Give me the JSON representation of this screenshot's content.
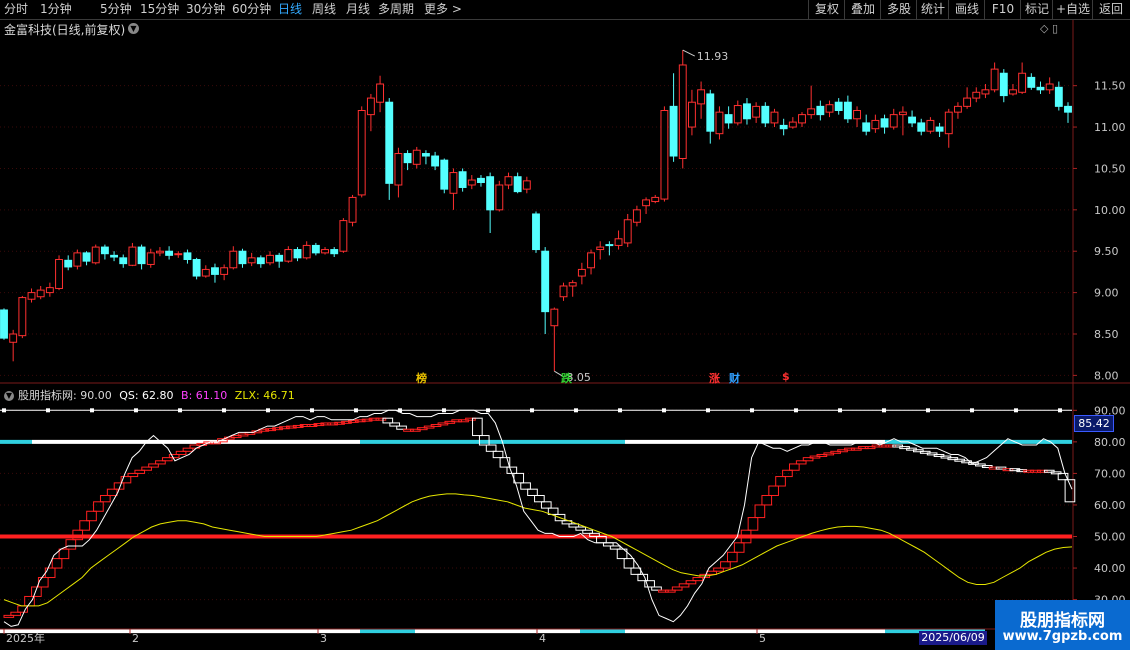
{
  "toolbar": {
    "periods": [
      "分时",
      "1分钟",
      "5分钟",
      "15分钟",
      "30分钟",
      "60分钟",
      "日线",
      "周线",
      "月线",
      "多周期",
      "更多 >"
    ],
    "active_period": "日线",
    "actions": [
      "复权",
      "叠加",
      "多股",
      "统计",
      "画线",
      "F10",
      "标记",
      "+自选",
      "返回"
    ]
  },
  "stock": {
    "title": "金富科技(日线,前复权)"
  },
  "pane_icons": "◇ ▯",
  "markers": [
    {
      "text": "榜",
      "color": "#e8c000"
    },
    {
      "text": "跌",
      "color": "#30d030"
    },
    {
      "text": "涨",
      "color": "#ff3030"
    },
    {
      "text": "财",
      "color": "#30a0ff"
    },
    {
      "text": "$",
      "color": "#ff3030"
    }
  ],
  "price_labels": {
    "high": "11.93",
    "low": "8.05"
  },
  "indicator": {
    "name": "股朋指标网",
    "value": ": 90.00",
    "qs": "QS: 62.80",
    "b": "B: 61.10",
    "zlx": "ZLX: 46.71",
    "current_value": "85.42"
  },
  "timeline": {
    "labels": [
      "2025年",
      "2",
      "3",
      "4",
      "5"
    ],
    "badge": "2025/06/09"
  },
  "watermark": {
    "line1": "股朋指标网",
    "line2": "www.7gpzb.com"
  },
  "colors": {
    "up": "#ff3030",
    "down": "#54ffff",
    "zlx": "#e6e600",
    "b": "#ffffff",
    "qs_band": "#ff2020"
  },
  "chart_data": [
    {
      "type": "candlestick",
      "title": "金富科技(日线,前复权)",
      "y_ticks": [
        8.0,
        8.5,
        9.0,
        9.5,
        10.0,
        10.5,
        11.0,
        11.5
      ],
      "ylim": [
        7.92,
        12.1
      ],
      "candles": [
        [
          8.79,
          8.45,
          8.81,
          8.43
        ],
        [
          8.4,
          8.5,
          8.55,
          8.17
        ],
        [
          8.48,
          8.94,
          8.96,
          8.45
        ],
        [
          8.92,
          9.0,
          9.05,
          8.88
        ],
        [
          8.95,
          9.03,
          9.08,
          8.92
        ],
        [
          9.0,
          9.06,
          9.12,
          8.95
        ],
        [
          9.05,
          9.4,
          9.45,
          9.03
        ],
        [
          9.39,
          9.31,
          9.45,
          9.27
        ],
        [
          9.32,
          9.48,
          9.52,
          9.28
        ],
        [
          9.48,
          9.38,
          9.5,
          9.33
        ],
        [
          9.36,
          9.55,
          9.58,
          9.34
        ],
        [
          9.55,
          9.47,
          9.58,
          9.4
        ],
        [
          9.45,
          9.43,
          9.5,
          9.38
        ],
        [
          9.42,
          9.35,
          9.46,
          9.3
        ],
        [
          9.33,
          9.55,
          9.6,
          9.32
        ],
        [
          9.55,
          9.35,
          9.58,
          9.28
        ],
        [
          9.34,
          9.48,
          9.53,
          9.3
        ],
        [
          9.48,
          9.5,
          9.55,
          9.44
        ],
        [
          9.5,
          9.45,
          9.56,
          9.4
        ],
        [
          9.46,
          9.47,
          9.5,
          9.42
        ],
        [
          9.48,
          9.4,
          9.52,
          9.35
        ],
        [
          9.4,
          9.2,
          9.42,
          9.16
        ],
        [
          9.2,
          9.28,
          9.33,
          9.18
        ],
        [
          9.3,
          9.22,
          9.35,
          9.12
        ],
        [
          9.22,
          9.3,
          9.34,
          9.15
        ],
        [
          9.3,
          9.5,
          9.56,
          9.28
        ],
        [
          9.5,
          9.35,
          9.53,
          9.3
        ],
        [
          9.36,
          9.42,
          9.48,
          9.32
        ],
        [
          9.42,
          9.35,
          9.45,
          9.3
        ],
        [
          9.36,
          9.45,
          9.5,
          9.33
        ],
        [
          9.45,
          9.38,
          9.48,
          9.3
        ],
        [
          9.38,
          9.52,
          9.56,
          9.36
        ],
        [
          9.52,
          9.42,
          9.55,
          9.38
        ],
        [
          9.42,
          9.57,
          9.62,
          9.4
        ],
        [
          9.57,
          9.48,
          9.6,
          9.45
        ],
        [
          9.48,
          9.52,
          9.55,
          9.46
        ],
        [
          9.52,
          9.47,
          9.55,
          9.43
        ],
        [
          9.5,
          9.87,
          9.9,
          9.48
        ],
        [
          9.85,
          10.15,
          10.18,
          9.8
        ],
        [
          10.18,
          11.2,
          11.25,
          10.15
        ],
        [
          11.15,
          11.35,
          11.4,
          10.95
        ],
        [
          11.3,
          11.52,
          11.62,
          11.18
        ],
        [
          11.3,
          10.32,
          11.35,
          10.12
        ],
        [
          10.3,
          10.68,
          10.75,
          10.15
        ],
        [
          10.68,
          10.57,
          10.72,
          10.48
        ],
        [
          10.55,
          10.72,
          10.76,
          10.5
        ],
        [
          10.68,
          10.65,
          10.72,
          10.55
        ],
        [
          10.65,
          10.53,
          10.7,
          10.48
        ],
        [
          10.6,
          10.25,
          10.62,
          10.2
        ],
        [
          10.2,
          10.45,
          10.5,
          10.0
        ],
        [
          10.46,
          10.27,
          10.5,
          10.22
        ],
        [
          10.3,
          10.36,
          10.42,
          10.25
        ],
        [
          10.38,
          10.33,
          10.42,
          10.28
        ],
        [
          10.4,
          10.0,
          10.45,
          9.72
        ],
        [
          10.0,
          10.3,
          10.35,
          9.98
        ],
        [
          10.3,
          10.4,
          10.45,
          10.25
        ],
        [
          10.4,
          10.22,
          10.45,
          10.2
        ],
        [
          10.25,
          10.35,
          10.4,
          10.2
        ],
        [
          9.95,
          9.52,
          9.98,
          9.48
        ],
        [
          9.5,
          8.77,
          9.55,
          8.5
        ],
        [
          8.6,
          8.8,
          8.82,
          8.05
        ],
        [
          8.95,
          9.08,
          9.12,
          8.9
        ],
        [
          9.08,
          9.12,
          9.15,
          8.95
        ],
        [
          9.2,
          9.28,
          9.36,
          9.1
        ],
        [
          9.3,
          9.48,
          9.52,
          9.22
        ],
        [
          9.52,
          9.55,
          9.62,
          9.4
        ],
        [
          9.58,
          9.57,
          9.62,
          9.45
        ],
        [
          9.57,
          9.65,
          9.75,
          9.52
        ],
        [
          9.6,
          9.88,
          9.95,
          9.55
        ],
        [
          9.85,
          10.0,
          10.05,
          9.8
        ],
        [
          10.05,
          10.12,
          10.15,
          9.95
        ],
        [
          10.1,
          10.15,
          10.18,
          10.08
        ],
        [
          10.13,
          11.2,
          11.25,
          10.1
        ],
        [
          11.25,
          10.65,
          11.65,
          10.58
        ],
        [
          10.62,
          11.75,
          11.93,
          10.5
        ],
        [
          11.0,
          11.3,
          11.45,
          10.9
        ],
        [
          11.28,
          11.45,
          11.55,
          11.1
        ],
        [
          11.4,
          10.95,
          11.45,
          10.8
        ],
        [
          10.92,
          11.18,
          11.25,
          10.85
        ],
        [
          11.15,
          11.05,
          11.25,
          10.98
        ],
        [
          11.05,
          11.26,
          11.32,
          11.02
        ],
        [
          11.28,
          11.1,
          11.35,
          11.03
        ],
        [
          11.12,
          11.25,
          11.3,
          11.05
        ],
        [
          11.25,
          11.05,
          11.3,
          11.0
        ],
        [
          11.05,
          11.18,
          11.22,
          11.0
        ],
        [
          11.02,
          10.98,
          11.1,
          10.9
        ],
        [
          11.0,
          11.06,
          11.12,
          10.98
        ],
        [
          11.05,
          11.15,
          11.18,
          11.0
        ],
        [
          11.15,
          11.22,
          11.5,
          11.1
        ],
        [
          11.25,
          11.15,
          11.32,
          11.08
        ],
        [
          11.18,
          11.27,
          11.32,
          11.12
        ],
        [
          11.3,
          11.2,
          11.35,
          11.15
        ],
        [
          11.3,
          11.1,
          11.38,
          11.05
        ],
        [
          11.1,
          11.2,
          11.25,
          11.0
        ],
        [
          11.05,
          10.95,
          11.15,
          10.9
        ],
        [
          10.98,
          11.08,
          11.15,
          10.93
        ],
        [
          11.1,
          11.0,
          11.15,
          10.92
        ],
        [
          11.0,
          11.15,
          11.22,
          10.97
        ],
        [
          11.15,
          11.18,
          11.25,
          10.9
        ],
        [
          11.12,
          11.05,
          11.2,
          11.0
        ],
        [
          11.05,
          10.95,
          11.1,
          10.9
        ],
        [
          10.95,
          11.08,
          11.12,
          10.92
        ],
        [
          11.0,
          10.95,
          11.05,
          10.88
        ],
        [
          10.92,
          11.18,
          11.22,
          10.75
        ],
        [
          11.18,
          11.25,
          11.3,
          11.1
        ],
        [
          11.25,
          11.35,
          11.48,
          11.22
        ],
        [
          11.35,
          11.42,
          11.48,
          11.3
        ],
        [
          11.4,
          11.45,
          11.52,
          11.35
        ],
        [
          11.45,
          11.7,
          11.78,
          11.42
        ],
        [
          11.65,
          11.38,
          11.7,
          11.3
        ],
        [
          11.4,
          11.45,
          11.52,
          11.38
        ],
        [
          11.42,
          11.65,
          11.78,
          11.4
        ],
        [
          11.6,
          11.48,
          11.65,
          11.45
        ],
        [
          11.48,
          11.45,
          11.55,
          11.4
        ],
        [
          11.45,
          11.52,
          11.6,
          11.4
        ],
        [
          11.48,
          11.25,
          11.55,
          11.2
        ],
        [
          11.25,
          11.18,
          11.3,
          11.05
        ]
      ]
    },
    {
      "type": "line",
      "title": "股朋指标网",
      "y_ticks": [
        30.0,
        40.0,
        50.0,
        60.0,
        70.0,
        80.0,
        90.0
      ],
      "ylim": [
        21,
        92
      ],
      "reference_lines": [
        {
          "name": "90",
          "value": 90
        },
        {
          "name": "80",
          "value": 80
        },
        {
          "name": "50",
          "value": 50
        },
        {
          "name": "20",
          "value": 20
        }
      ],
      "series": [
        {
          "name": "B",
          "values": [
            23,
            21.5,
            22,
            27,
            30,
            36,
            39,
            44,
            46,
            47,
            47,
            47,
            49,
            52,
            56,
            60,
            64,
            70,
            75,
            77,
            80,
            82,
            80,
            78,
            74,
            75,
            76,
            78,
            79,
            80,
            80,
            81,
            82,
            83,
            83,
            83,
            84,
            85,
            85,
            86,
            87,
            88,
            88,
            87,
            88,
            88,
            87,
            87,
            87,
            87,
            88,
            88,
            89,
            89,
            90,
            90,
            89,
            89,
            88,
            88,
            88,
            89,
            89,
            89,
            90,
            90,
            90,
            89,
            89,
            86,
            80,
            72,
            66,
            58,
            55,
            52,
            51,
            51,
            50,
            50,
            50,
            51,
            49,
            48,
            48,
            48,
            48,
            46,
            44,
            41,
            37,
            30,
            25,
            24,
            23,
            25,
            28,
            32,
            35,
            40,
            42,
            44,
            47,
            50,
            60,
            75,
            80,
            79,
            78,
            78,
            77,
            78,
            79,
            79,
            80,
            80,
            79,
            79,
            79,
            79,
            80,
            80,
            80,
            79,
            80,
            81,
            80,
            80,
            79,
            78,
            78,
            78,
            77,
            76,
            76,
            75,
            73,
            74,
            75,
            77,
            79,
            81,
            80,
            79,
            79,
            79,
            81,
            80,
            78,
            70,
            65
          ]
        },
        {
          "name": "QS",
          "values": [
            24.5,
            25,
            26,
            28,
            31,
            34,
            37,
            40,
            43,
            46,
            49,
            52,
            55,
            58,
            61,
            63,
            65,
            67,
            69,
            70,
            71,
            72,
            73,
            74,
            75,
            76,
            77,
            78,
            79,
            79.5,
            80,
            80,
            81,
            81.5,
            82,
            82.5,
            83,
            83.5,
            84,
            84.2,
            84.5,
            84.8,
            85,
            85.2,
            85.5,
            85.5,
            85.8,
            86,
            86,
            86.2,
            86.5,
            86.8,
            87,
            87.2,
            87.5,
            87.5,
            86,
            85,
            84,
            84,
            84,
            84.5,
            85,
            85.5,
            86,
            86.5,
            87,
            87,
            87.5,
            82,
            79,
            77,
            75,
            72,
            70,
            67,
            65,
            63,
            61,
            59,
            57,
            55,
            54,
            53,
            52,
            51,
            50,
            48,
            47,
            46,
            43,
            40,
            38,
            36,
            34,
            33,
            33,
            33,
            34,
            35,
            36,
            37,
            38,
            39,
            40,
            42,
            45,
            48,
            52,
            56,
            60,
            63,
            66,
            69,
            71,
            73,
            74,
            75,
            75.5,
            76,
            76.5,
            77,
            77.5,
            78,
            78,
            78.5,
            78.5,
            79,
            79,
            79,
            78.5,
            78,
            77.5,
            77,
            76.5,
            76,
            75.5,
            75,
            74.5,
            74,
            73.5,
            73,
            72.5,
            72,
            72,
            71.5,
            71.5,
            71.2,
            71,
            71,
            71,
            71,
            70.5,
            70,
            68,
            61
          ]
        },
        {
          "name": "ZLX",
          "values": [
            30,
            29,
            28,
            28,
            28,
            29,
            31,
            33,
            35,
            37,
            40,
            42,
            44,
            46,
            48,
            50,
            51.5,
            53,
            54,
            54.5,
            55,
            55,
            54.5,
            54,
            53,
            52.5,
            52,
            51.5,
            51,
            50.5,
            50,
            50,
            50,
            50,
            50,
            50,
            50,
            50.5,
            51,
            51.5,
            52,
            53,
            54,
            55,
            56.5,
            58,
            59.5,
            61,
            62,
            62.8,
            63.2,
            63.5,
            63.5,
            63.2,
            63,
            62.5,
            62,
            61.5,
            61,
            60,
            59,
            58.5,
            58,
            57,
            56,
            55,
            54,
            53,
            52,
            51,
            50,
            48.5,
            47,
            45.5,
            44,
            42.5,
            41,
            39.5,
            38.5,
            38,
            37.5,
            37.5,
            38,
            39,
            40,
            41,
            42.5,
            44,
            45.5,
            47,
            48,
            49,
            50,
            51,
            51.8,
            52.5,
            53,
            53.2,
            53.2,
            53,
            52.5,
            52,
            51,
            49.5,
            48,
            46.5,
            45,
            43,
            41,
            39,
            37,
            35.5,
            34.8,
            34.8,
            35.5,
            37,
            38.5,
            40,
            42,
            43.5,
            45,
            46,
            46.5,
            46.71
          ]
        }
      ],
      "values_header": {
        "value": 90.0,
        "QS": 62.8,
        "B": 61.1,
        "ZLX": 46.71
      }
    }
  ]
}
